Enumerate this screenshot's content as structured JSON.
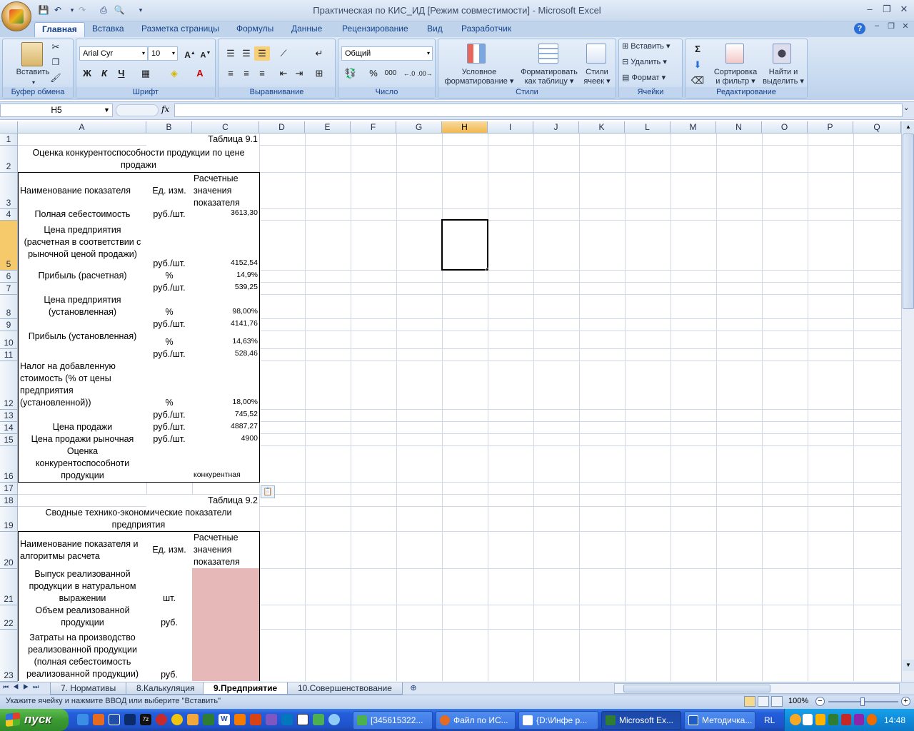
{
  "window": {
    "title": "Практическая по КИС_ИД  [Режим совместимости] - Microsoft Excel",
    "controls": [
      "–",
      "❐",
      "✕"
    ]
  },
  "ribbon": {
    "tabs": [
      "Главная",
      "Вставка",
      "Разметка страницы",
      "Формулы",
      "Данные",
      "Рецензирование",
      "Вид",
      "Разработчик"
    ],
    "active_tab": "Главная",
    "groups": {
      "clipboard": {
        "label": "Буфер обмена",
        "paste": "Вставить"
      },
      "font": {
        "label": "Шрифт",
        "font_name": "Arial Cyr",
        "font_size": "10",
        "bold": "Ж",
        "italic": "К",
        "underline": "Ч"
      },
      "alignment": {
        "label": "Выравнивание"
      },
      "number": {
        "label": "Число",
        "format": "Общий",
        "percent": "%",
        "thousands": "000"
      },
      "styles": {
        "label": "Стили",
        "conditional": "Условное\nформатирование",
        "conditional_1": "Условное",
        "conditional_2": "форматирование",
        "table_1": "Форматировать",
        "table_2": "как таблицу",
        "cell_1": "Стили",
        "cell_2": "ячеек"
      },
      "cells": {
        "label": "Ячейки",
        "insert": "Вставить",
        "delete": "Удалить",
        "format": "Формат"
      },
      "editing": {
        "label": "Редактирование",
        "sort_1": "Сортировка",
        "sort_2": "и фильтр",
        "find_1": "Найти и",
        "find_2": "выделить",
        "sigma": "Σ"
      }
    }
  },
  "formula_bar": {
    "name_box": "H5",
    "fx": "fx",
    "formula": ""
  },
  "columns": [
    "A",
    "B",
    "C",
    "D",
    "E",
    "F",
    "G",
    "H",
    "I",
    "J",
    "K",
    "L",
    "M",
    "N",
    "O",
    "P",
    "Q"
  ],
  "selected_column": "H",
  "selected_row": "5",
  "rows": [
    "1",
    "2",
    "3",
    "4",
    "5",
    "6",
    "7",
    "8",
    "9",
    "10",
    "11",
    "12",
    "13",
    "14",
    "15",
    "16",
    "17",
    "18",
    "19",
    "20",
    "21",
    "22",
    "23"
  ],
  "sheet": {
    "r1": {
      "c": "Таблица 9.1"
    },
    "r2": {
      "a": "Оценка конкурентоспособности продукции по цене продажи"
    },
    "r3": {
      "a": "Наименование показателя",
      "b": "Ед. изм.",
      "c": "Расчетные значения показателя"
    },
    "r4": {
      "a": "Полная себестоимость",
      "b": "руб./шт.",
      "c": "3613,30"
    },
    "r5": {
      "a": "Цена предприятия (расчетная в соответствии с рыночной ценой продажи)",
      "b": "руб./шт.",
      "c": "4152,54"
    },
    "r6": {
      "a": "Прибыль (расчетная)",
      "b": "%",
      "c": "14,9%"
    },
    "r7": {
      "a": "",
      "b": "руб./шт.",
      "c": "539,25"
    },
    "r8": {
      "a": "Цена предприятия (установленная)",
      "b": "%",
      "c": "98,00%"
    },
    "r9": {
      "a": "",
      "b": "руб./шт.",
      "c": "4141,76"
    },
    "r10": {
      "a": "Прибыль (установленная)",
      "b": "%",
      "c": "14,63%"
    },
    "r11": {
      "a": "",
      "b": "руб./шт.",
      "c": "528,46"
    },
    "r12": {
      "a": "Налог на добавленную стоимость (% от цены предприятия (установленной))",
      "b": "%",
      "c": "18,00%"
    },
    "r13": {
      "a": "",
      "b": "руб./шт.",
      "c": "745,52"
    },
    "r14": {
      "a": "Цена продажи",
      "b": "руб./шт.",
      "c": "4887,27"
    },
    "r15": {
      "a": "Цена продажи рыночная",
      "b": "руб./шт.",
      "c": "4900"
    },
    "r16": {
      "a": "Оценка конкурентоспособноти продукции",
      "b": "",
      "c": "конкурентная"
    },
    "r18": {
      "c": "Таблица 9.2"
    },
    "r19": {
      "a": "Сводные технико-экономические показатели предприятия"
    },
    "r20": {
      "a": "Наименование показателя и алгоритмы расчета",
      "b": "Ед. изм.",
      "c": "Расчетные значения показателя"
    },
    "r21": {
      "a": "Выпуск реализованной продукции в натуральном выражении",
      "b": "шт.",
      "c": ""
    },
    "r22": {
      "a": "Объем реализованной продукции",
      "b": "руб.",
      "c": ""
    },
    "r23": {
      "a": "Затраты на производство реализованной продукции (полная себестоимость реализованной продукции)",
      "b": "руб.",
      "c": ""
    }
  },
  "sheet_tabs": [
    "7. Нормативы",
    "8.Калькуляция",
    "9.Предприятие",
    "10.Совершенствование"
  ],
  "active_sheet": "9.Предприятие",
  "status": {
    "message": "Укажите ячейку и нажмите ВВОД или выберите \"Вставить\"",
    "zoom": "100%"
  },
  "taskbar": {
    "start": "пуск",
    "buttons": [
      "[345615322...",
      "Файл по ИС...",
      "{D:\\Инфе р...",
      "Microsoft Ex...",
      "Методичка..."
    ],
    "active_button": "Microsoft Ex...",
    "lang": "RL",
    "clock": "14:48"
  },
  "colors": {
    "accent": "#15428b",
    "highlight_fill": "#e6b9b8",
    "selected_header": "#f1b84f"
  }
}
